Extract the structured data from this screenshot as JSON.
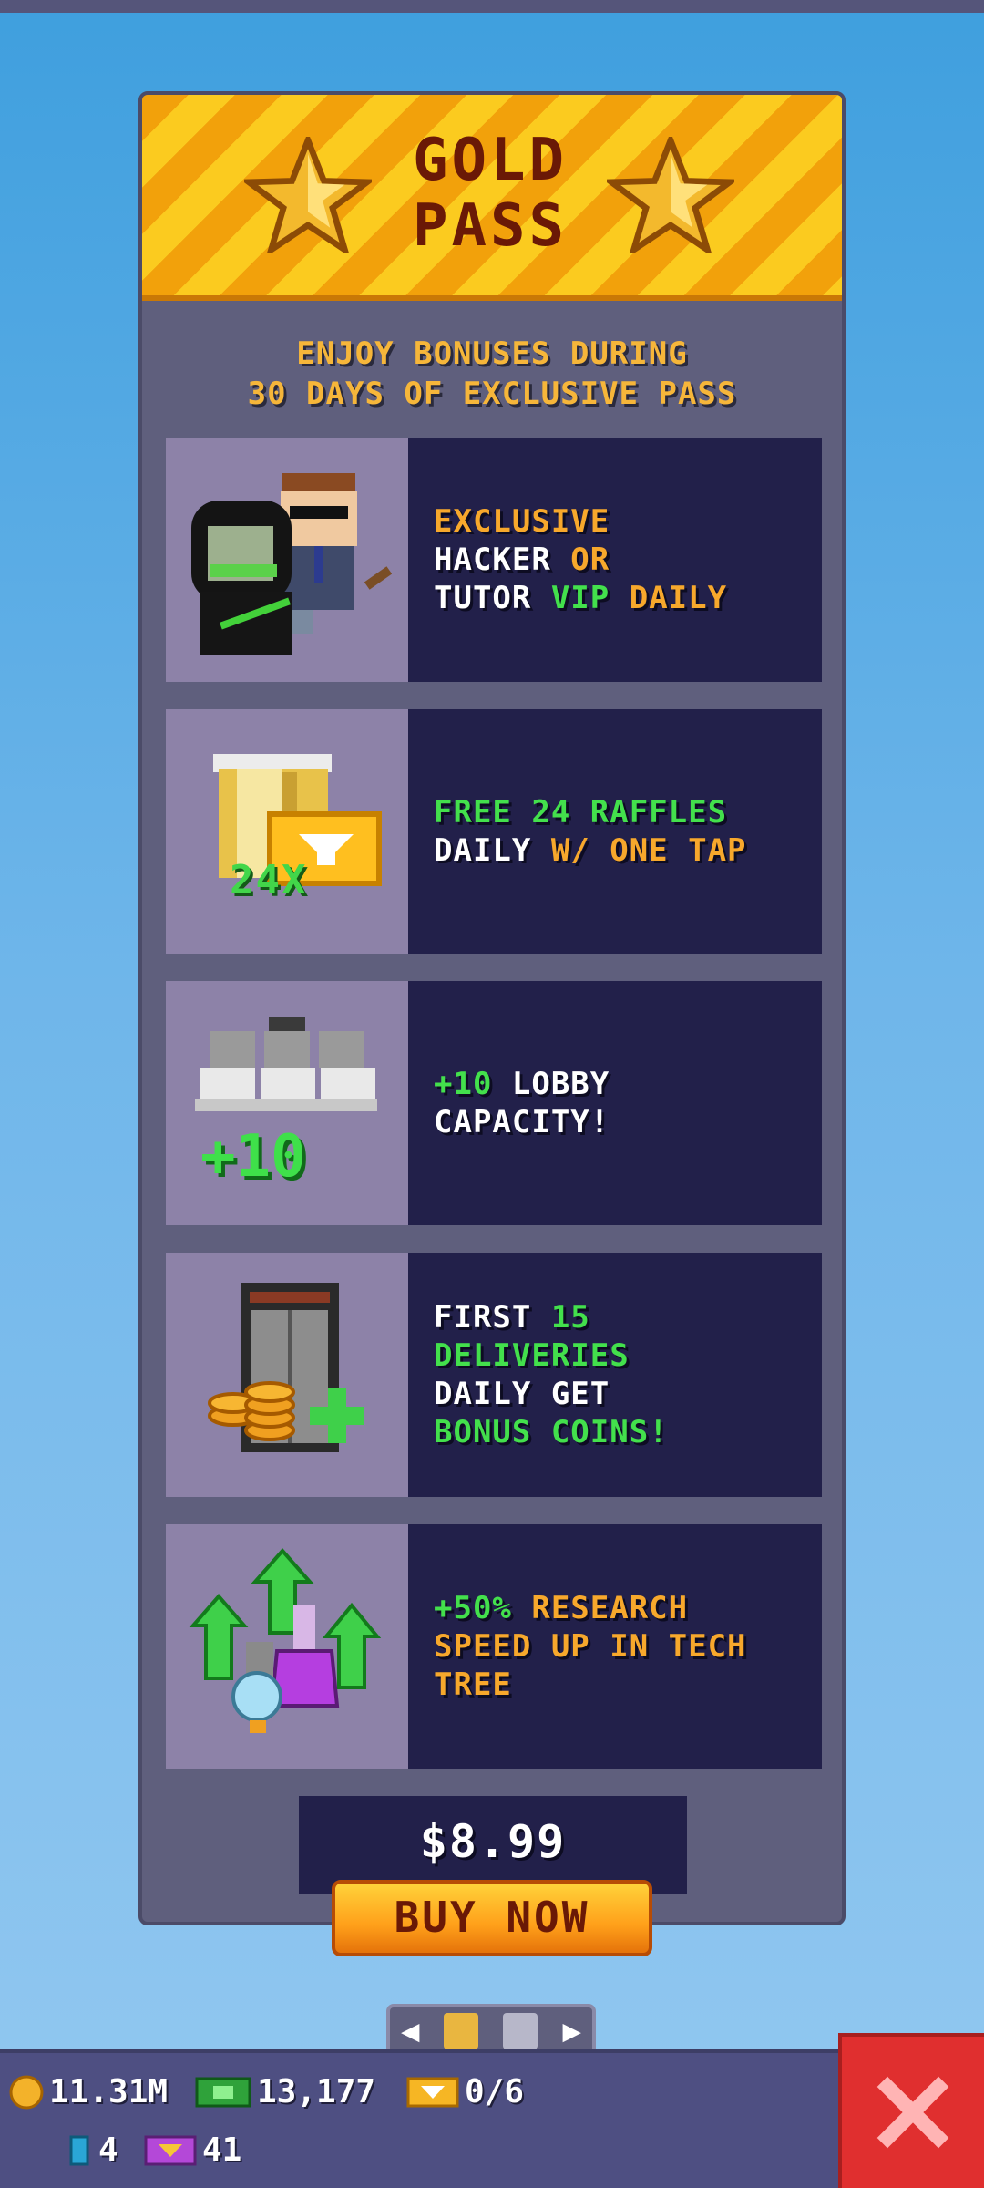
{
  "banner": {
    "title": "GOLD\nPASS"
  },
  "subtitle": "ENJOY BONUSES DURING\n30 DAYS OF EXCLUSIVE PASS",
  "perks": [
    {
      "icon": "hacker-tutor-vip-icon",
      "lines": [
        [
          {
            "t": "EXCLUSIVE",
            "c": "orange"
          }
        ],
        [
          {
            "t": "HACKER ",
            "c": "white"
          },
          {
            "t": "OR",
            "c": "orange"
          }
        ],
        [
          {
            "t": "TUTOR ",
            "c": "white"
          },
          {
            "t": "VIP ",
            "c": "green"
          },
          {
            "t": "DAILY",
            "c": "orange"
          }
        ]
      ]
    },
    {
      "icon": "raffle-tickets-icon",
      "badge": "24X",
      "lines": [
        [
          {
            "t": "FREE 24 RAFFLES",
            "c": "green"
          }
        ],
        [
          {
            "t": "DAILY ",
            "c": "white"
          },
          {
            "t": "W/ ONE TAP",
            "c": "orange"
          }
        ]
      ]
    },
    {
      "icon": "lobby-seats-icon",
      "badge": "+10",
      "lines": [
        [
          {
            "t": "+10 ",
            "c": "green"
          },
          {
            "t": "LOBBY",
            "c": "white"
          }
        ],
        [
          {
            "t": "CAPACITY!",
            "c": "white"
          }
        ]
      ]
    },
    {
      "icon": "elevator-coins-icon",
      "lines": [
        [
          {
            "t": "FIRST ",
            "c": "white"
          },
          {
            "t": "15",
            "c": "green"
          }
        ],
        [
          {
            "t": "DELIVERIES",
            "c": "green"
          }
        ],
        [
          {
            "t": "DAILY GET",
            "c": "white"
          }
        ],
        [
          {
            "t": "BONUS COINS!",
            "c": "green"
          }
        ]
      ]
    },
    {
      "icon": "research-potions-icon",
      "lines": [
        [
          {
            "t": "+50% ",
            "c": "green"
          },
          {
            "t": "RESEARCH",
            "c": "orange"
          }
        ],
        [
          {
            "t": "SPEED UP IN TECH",
            "c": "orange"
          }
        ],
        [
          {
            "t": "TREE",
            "c": "orange"
          }
        ]
      ]
    }
  ],
  "price": "$8.99",
  "buy_label": "BUY NOW",
  "pager": {
    "prev": "◀",
    "next": "▶"
  },
  "resources": {
    "coins": "11.31M",
    "cash": "13,177",
    "tickets": "0/6",
    "gems": "4",
    "vip_tickets": "41"
  },
  "colors": {
    "white": "#ffffff",
    "orange": "#f7a82c",
    "green": "#43e04c"
  }
}
